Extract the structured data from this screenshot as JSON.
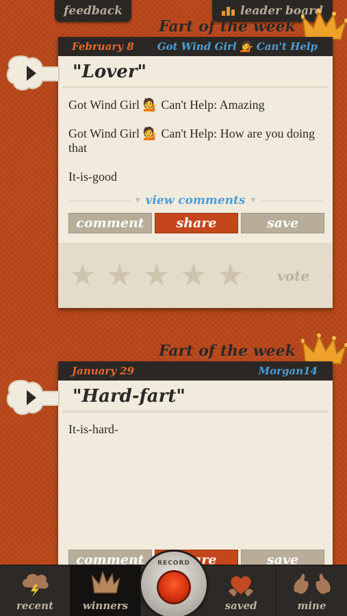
{
  "header": {
    "feedback_label": "feedback",
    "leaderboard_label": "leader board"
  },
  "posts": [
    {
      "badge": "Fart of the week",
      "date": "February 8",
      "user": "Got Wind Girl 💁 Can't Help",
      "title": "\"Lover\"",
      "comments": [
        "Got Wind Girl 💁 Can't Help: Amazing",
        "Got Wind Girl 💁 Can't Help: How are you doing that",
        "It-is-good"
      ],
      "view_comments_label": "view comments",
      "comment_label": "comment",
      "share_label": "share",
      "save_label": "save",
      "vote_label": "vote",
      "rating": 0,
      "stars_total": 5
    },
    {
      "badge": "Fart of the week",
      "date": "January 29",
      "user": "Morgan14",
      "title": "\"Hard-fart\"",
      "comments": [
        "It-is-hard-"
      ],
      "comment_label": "comment",
      "share_label": "share",
      "save_label": "save"
    }
  ],
  "tabbar": {
    "recent": "recent",
    "winners": "winners",
    "record": "RECORD",
    "saved": "saved",
    "mine": "mine",
    "active": "winners"
  },
  "colors": {
    "background": "#b9471a",
    "card": "#f1ebde",
    "header_dark": "#2b2724",
    "date_orange": "#e26a32",
    "user_blue": "#4c9ed6",
    "share_red": "#c4461a"
  }
}
